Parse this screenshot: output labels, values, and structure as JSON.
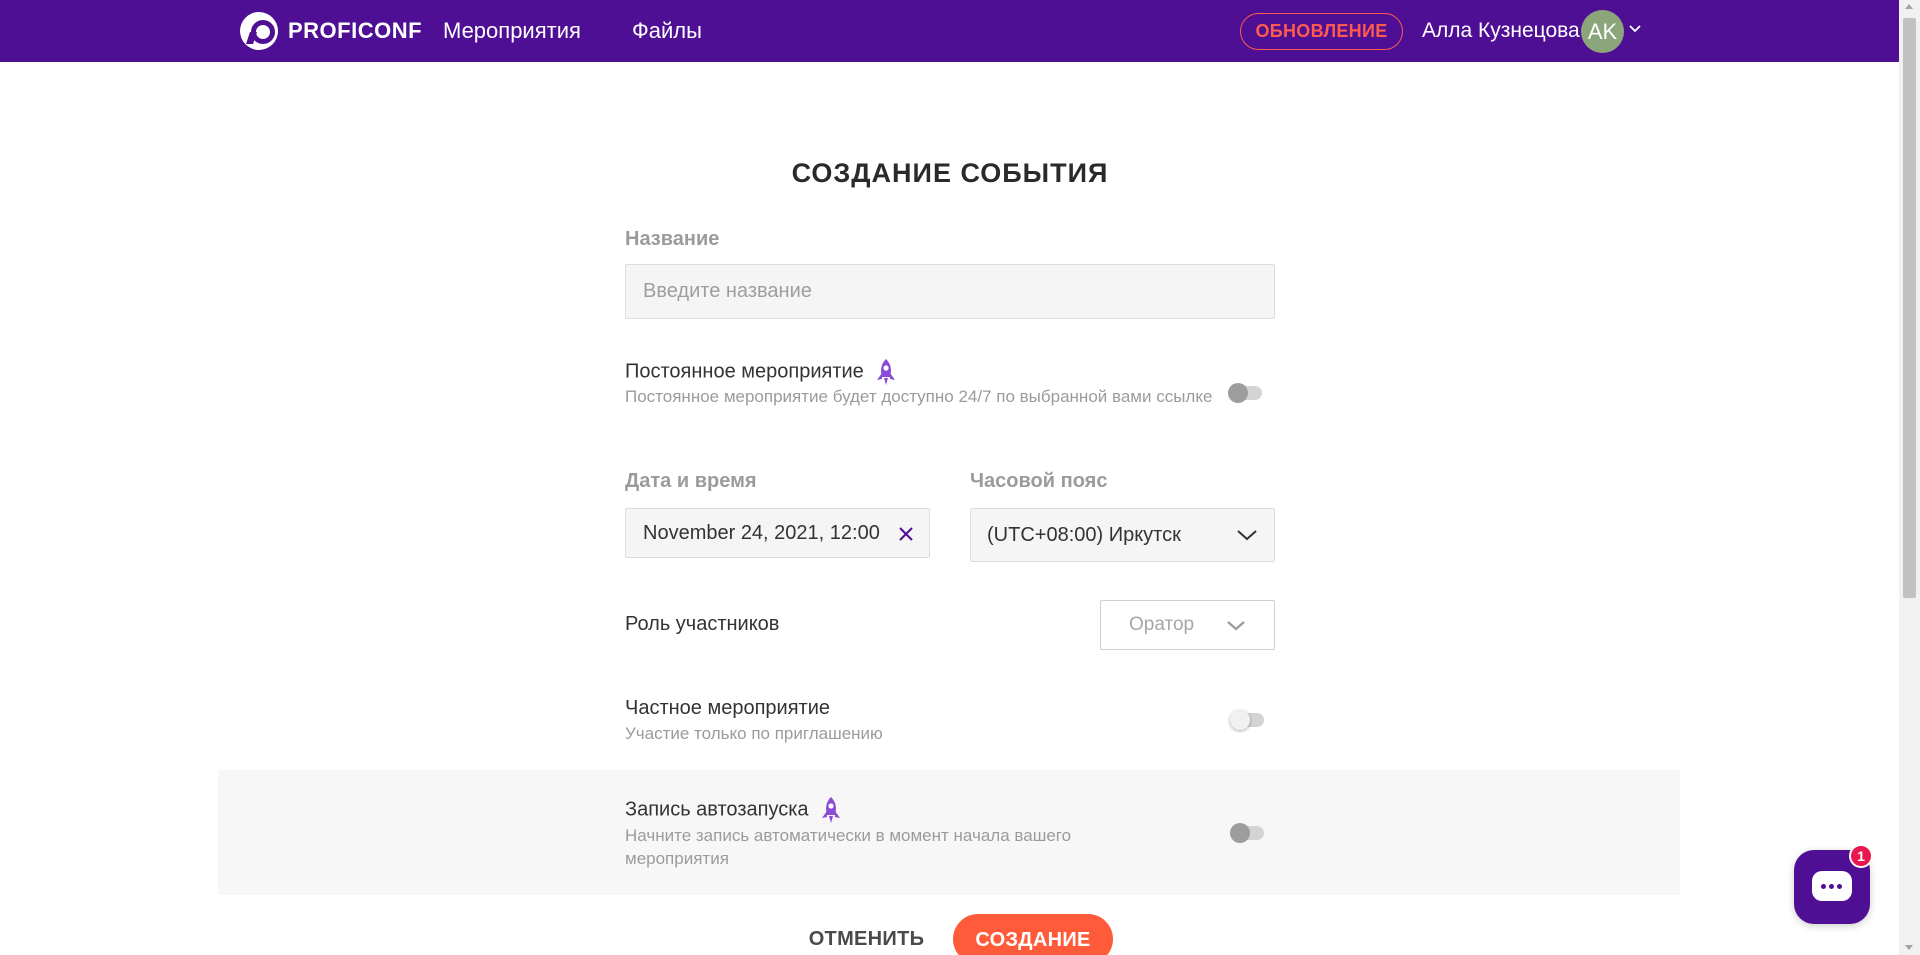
{
  "header": {
    "logo_text": "PROFICONF",
    "nav": [
      {
        "label": "Мероприятия"
      },
      {
        "label": "Файлы"
      }
    ],
    "update_label": "ОБНОВЛЕНИЕ",
    "user_name": "Алла Кузнецова",
    "avatar_initials": "AK"
  },
  "form": {
    "title": "СОЗДАНИЕ СОБЫТИЯ",
    "name_label": "Название",
    "name_placeholder": "Введите название",
    "name_value": "",
    "permanent": {
      "title": "Постоянное мероприятие",
      "description": "Постоянное мероприятие будет доступно 24/7 по выбранной вами ссылке",
      "enabled": false,
      "premium_icon": "rocket-icon"
    },
    "datetime_label": "Дата и время",
    "datetime_value": "November 24, 2021, 12:00",
    "timezone_label": "Часовой пояс",
    "timezone_value": "(UTC+08:00) Иркутск",
    "role_label": "Роль участников",
    "role_value": "Оратор",
    "private": {
      "title": "Частное мероприятие",
      "description": "Участие только по приглашению",
      "enabled": false
    },
    "autorecord": {
      "title": "Запись автозапуска",
      "description": "Начните запись автоматически в момент начала вашего мероприятия",
      "enabled": false,
      "premium_icon": "rocket-icon"
    },
    "cancel_label": "ОТМЕНИТЬ",
    "create_label": "СОЗДАНИЕ"
  },
  "chat": {
    "badge_count": "1"
  },
  "colors": {
    "brand_purple": "#4e0f94",
    "accent_orange": "#ff5a3a",
    "update_red": "#ff5a4e",
    "badge_red": "#e8174f",
    "premium_purple": "#8a4bd6"
  }
}
